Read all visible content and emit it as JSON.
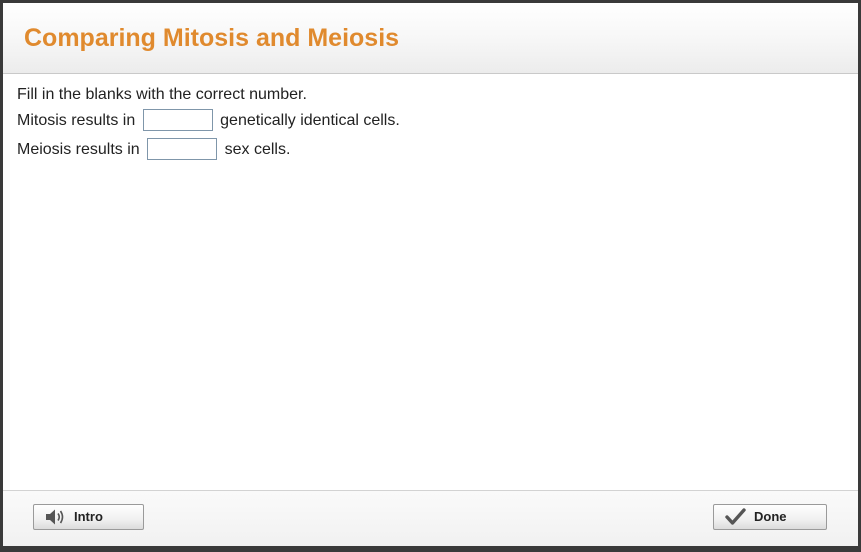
{
  "header": {
    "title": "Comparing Mitosis and Meiosis"
  },
  "content": {
    "instructions": "Fill in the blanks with the correct number.",
    "questions": [
      {
        "before": "Mitosis results in",
        "value": "",
        "after": "genetically identical cells."
      },
      {
        "before": "Meiosis results in",
        "value": "",
        "after": "sex cells."
      }
    ]
  },
  "footer": {
    "intro_label": "Intro",
    "intro_icon": "speaker-icon",
    "done_label": "Done",
    "done_icon": "checkmark-icon"
  },
  "colors": {
    "title": "#e08a2e",
    "input_border": "#7f96aa"
  }
}
